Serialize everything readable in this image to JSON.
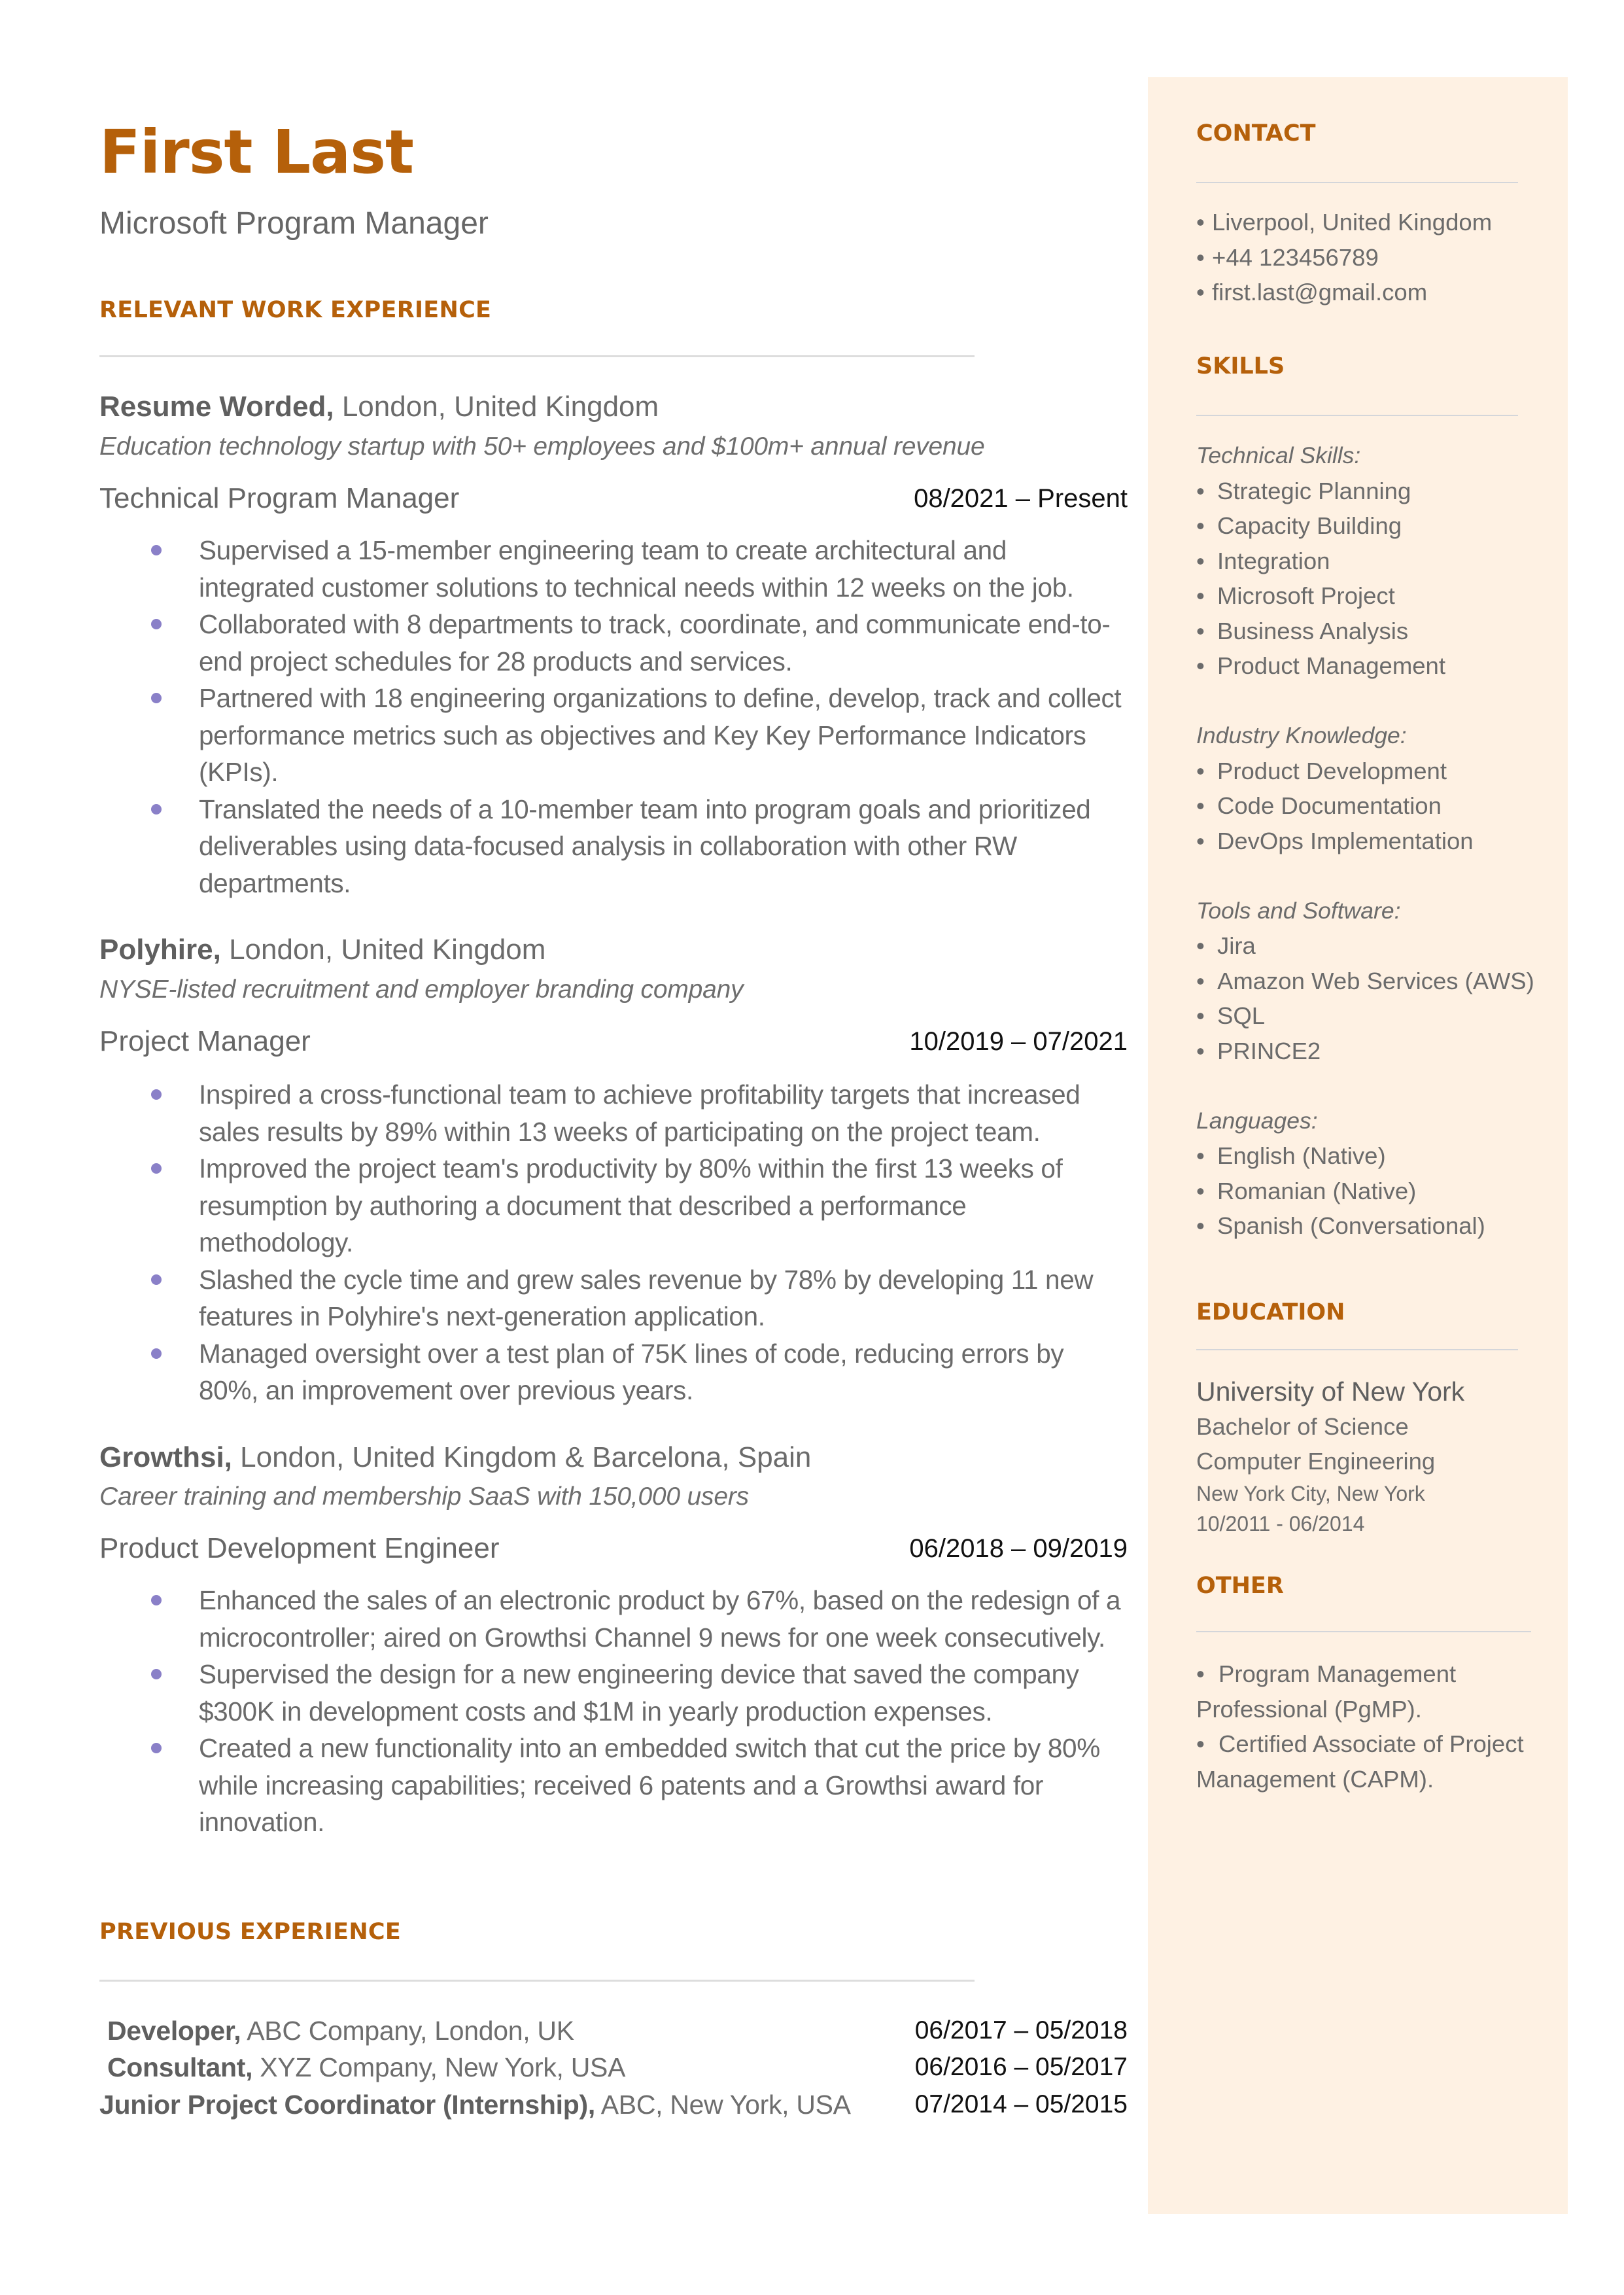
{
  "header": {
    "name": "First Last",
    "title": "Microsoft Program Manager"
  },
  "colors": {
    "accent": "#b5600a",
    "sidebar_bg": "#fef1e3",
    "bullet": "#8a80c8",
    "text": "#666666",
    "dates": "#111111"
  },
  "work": {
    "heading": "RELEVANT WORK EXPERIENCE",
    "jobs": [
      {
        "company": "Resume Worded,",
        "location": " London, United Kingdom",
        "description": "Education technology startup with 50+ employees and $100m+ annual revenue",
        "role": "Technical Program Manager",
        "dates": "08/2021 – Present",
        "bullets": [
          "Supervised a 15-member engineering team to create architectural and integrated customer solutions to technical needs within 12 weeks on the job.",
          "Collaborated with 8 departments to track, coordinate, and communicate end-to-end project schedules for 28 products and services.",
          "Partnered with 18 engineering organizations to define, develop, track and collect performance metrics such as objectives and Key Key Performance Indicators (KPIs).",
          "Translated the needs of a 10-member team into program goals and prioritized deliverables using data-focused analysis in collaboration with other RW departments."
        ]
      },
      {
        "company": "Polyhire,",
        "location": " London, United Kingdom",
        "description": "NYSE-listed recruitment and employer branding company",
        "role": "Project Manager",
        "dates": "10/2019 – 07/2021",
        "bullets": [
          "Inspired a cross-functional team to achieve profitability targets that increased sales results by 89% within 13 weeks of participating on the project team.",
          "Improved the project team's productivity by 80% within the first 13 weeks of resumption by authoring a document that described a  performance methodology.",
          "Slashed the cycle time and grew sales revenue by 78% by developing 11 new features in Polyhire's next-generation application.",
          "Managed oversight over a test plan of 75K lines of code, reducing errors by 80%, an improvement over previous years."
        ]
      },
      {
        "company": "Growthsi,",
        "location": " London, United Kingdom & Barcelona, Spain",
        "description": "Career training and membership SaaS with 150,000 users",
        "role": "Product Development Engineer",
        "dates": "06/2018 – 09/2019",
        "bullets": [
          "Enhanced the sales of an electronic product by 67%, based on the redesign of a microcontroller; aired on Growthsi Channel 9 news for one week consecutively.",
          "Supervised the design for a new engineering device that saved the company $300K in development costs and $1M in yearly production expenses.",
          "Created a new functionality into an embedded switch that cut the price by 80% while increasing capabilities; received 6 patents and a Growthsi award for innovation."
        ]
      }
    ]
  },
  "previous": {
    "heading": "PREVIOUS EXPERIENCE",
    "rows": [
      {
        "role": "Developer,",
        "detail": " ABC Company, London, UK",
        "dates": "06/2017 – 05/2018"
      },
      {
        "role": "Consultant,",
        "detail": " XYZ Company, New York, USA",
        "dates": "06/2016 – 05/2017"
      },
      {
        "role": "Junior Project Coordinator (Internship),",
        "detail": " ABC, New York, USA",
        "dates": "07/2014 – 05/2015"
      }
    ]
  },
  "sidebar": {
    "contact": {
      "heading": "CONTACT",
      "bullet": "•",
      "items": [
        "Liverpool, United Kingdom",
        "+44 123456789",
        "first.last@gmail.com"
      ]
    },
    "skills": {
      "heading": "SKILLS",
      "bullet": "•",
      "groups": [
        {
          "label": "Technical Skills:",
          "items": [
            "Strategic Planning",
            "Capacity Building",
            "Integration",
            "Microsoft Project",
            "Business Analysis",
            "Product Management"
          ]
        },
        {
          "label": "Industry Knowledge:",
          "items": [
            "Product Development",
            "Code Documentation",
            "DevOps Implementation"
          ]
        },
        {
          "label": "Tools and Software:",
          "items": [
            "Jira",
            "Amazon Web Services (AWS)",
            "SQL",
            "PRINCE2"
          ]
        },
        {
          "label": "Languages:",
          "items": [
            "English (Native)",
            "Romanian (Native)",
            "Spanish (Conversational)"
          ]
        }
      ]
    },
    "education": {
      "heading": "EDUCATION",
      "school": "University of New York",
      "degree": "Bachelor of Science",
      "field": "Computer Engineering",
      "location": "New York City, New York",
      "dates": "10/2011 - 06/2014"
    },
    "other": {
      "heading": "OTHER",
      "bullet": "•",
      "items": [
        "Program Management Professional (PgMP).",
        "Certified Associate of Project Management (CAPM)."
      ]
    }
  }
}
